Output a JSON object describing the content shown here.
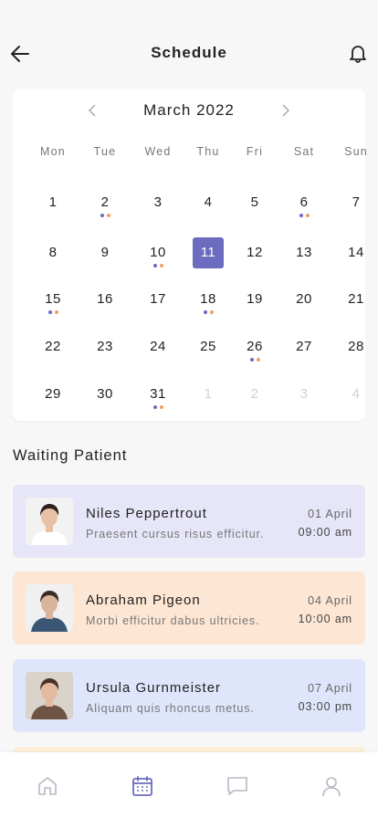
{
  "header": {
    "title": "Schedule",
    "back_icon": "arrow-left-icon",
    "notification_icon": "bell-icon"
  },
  "calendar": {
    "month_label": "March 2022",
    "weekdays": [
      "Mon",
      "Tue",
      "Wed",
      "Thu",
      "Fri",
      "Sat",
      "Sun"
    ],
    "selected_day": "11",
    "dot_colors": {
      "primary": "#6b6bbf",
      "secondary": "#f0a060"
    },
    "weeks": [
      [
        {
          "d": "1"
        },
        {
          "d": "2",
          "dots": true
        },
        {
          "d": "3"
        },
        {
          "d": "4"
        },
        {
          "d": "5"
        },
        {
          "d": "6",
          "dots": true
        },
        {
          "d": "7"
        }
      ],
      [
        {
          "d": "8"
        },
        {
          "d": "9"
        },
        {
          "d": "10",
          "dots": true
        },
        {
          "d": "11",
          "selected": true
        },
        {
          "d": "12"
        },
        {
          "d": "13"
        },
        {
          "d": "14"
        }
      ],
      [
        {
          "d": "15",
          "dots": true
        },
        {
          "d": "16"
        },
        {
          "d": "17"
        },
        {
          "d": "18",
          "dots": true
        },
        {
          "d": "19"
        },
        {
          "d": "20"
        },
        {
          "d": "21"
        }
      ],
      [
        {
          "d": "22"
        },
        {
          "d": "23"
        },
        {
          "d": "24"
        },
        {
          "d": "25"
        },
        {
          "d": "26",
          "dots": true
        },
        {
          "d": "27"
        },
        {
          "d": "28"
        }
      ],
      [
        {
          "d": "29"
        },
        {
          "d": "30"
        },
        {
          "d": "31",
          "dots": true
        },
        {
          "d": "1",
          "muted": true
        },
        {
          "d": "2",
          "muted": true
        },
        {
          "d": "3",
          "muted": true
        },
        {
          "d": "4",
          "muted": true
        }
      ]
    ]
  },
  "waiting": {
    "title": "Waiting Patient",
    "patients": [
      {
        "name": "Niles Peppertrout",
        "note": "Praesent cursus risus efficitur.",
        "date": "01 April",
        "time": "09:00 am",
        "bg": "#e6e6f8"
      },
      {
        "name": "Abraham Pigeon",
        "note": "Morbi efficitur dabus ultricies.",
        "date": "04 April",
        "time": "10:00 am",
        "bg": "#fde6d4"
      },
      {
        "name": "Ursula Gurnmeister",
        "note": "Aliquam quis rhoncus metus.",
        "date": "07 April",
        "time": "03:00 pm",
        "bg": "#dfe6fb"
      }
    ]
  },
  "tab_bar": {
    "tabs": [
      "home-icon",
      "calendar-icon",
      "chat-icon",
      "profile-icon"
    ],
    "active": "calendar-icon",
    "active_color": "#6b6bbf",
    "inactive_color": "#b8b8c4"
  }
}
